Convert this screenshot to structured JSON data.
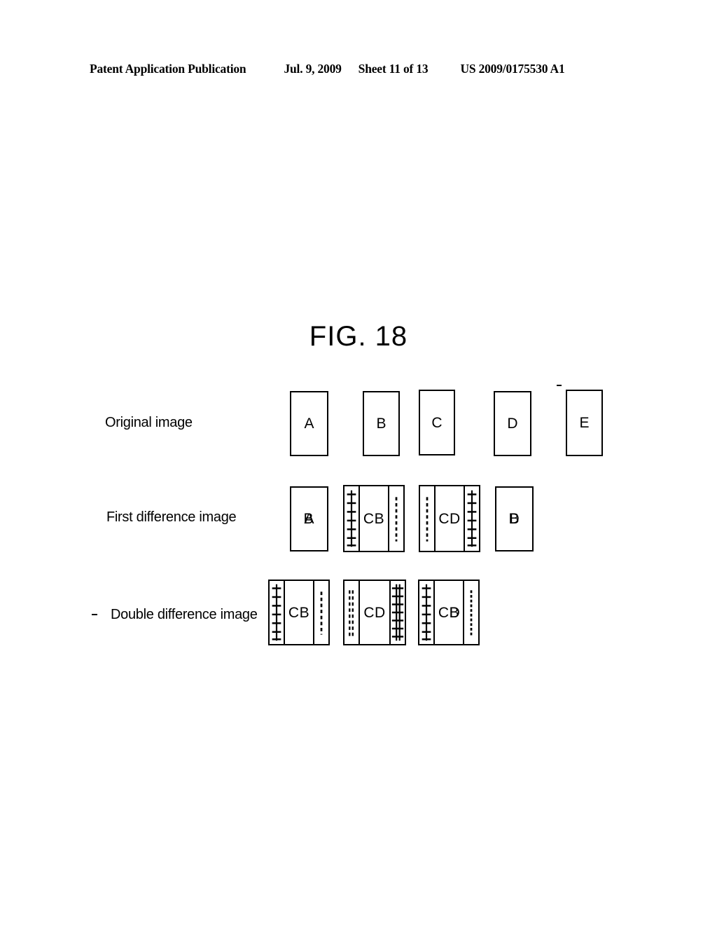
{
  "header": {
    "publication": "Patent Application Publication",
    "date": "Jul. 9, 2009",
    "sheet": "Sheet 11 of 13",
    "patent_number": "US 2009/0175530 A1"
  },
  "figure": {
    "title": "FIG. 18",
    "rows": [
      {
        "label": "Original image",
        "items": [
          {
            "type": "plain",
            "letters": [
              "A"
            ]
          },
          {
            "type": "plain",
            "letters": [
              "B"
            ]
          },
          {
            "type": "plain",
            "letters": [
              "C"
            ]
          },
          {
            "type": "plain",
            "letters": [
              "D"
            ]
          },
          {
            "type": "plain",
            "letters": [
              "E"
            ]
          }
        ]
      },
      {
        "label": "First difference image",
        "items": [
          {
            "type": "plain",
            "letters": [
              "A",
              "B"
            ]
          },
          {
            "type": "composite",
            "letters": [
              "C",
              "B"
            ],
            "left_strip": "cross-ticks",
            "right_strip": "dashed"
          },
          {
            "type": "composite",
            "letters": [
              "C",
              "D"
            ],
            "left_strip": "dashed",
            "right_strip": "cross-ticks"
          },
          {
            "type": "plain",
            "letters": [
              "B",
              "D"
            ]
          }
        ]
      },
      {
        "label": "Double difference image",
        "items": [
          {
            "type": "composite",
            "letters": [
              "C",
              "B"
            ],
            "left_strip": "cross-ticks",
            "right_strip": "dashed"
          },
          {
            "type": "composite",
            "letters": [
              "C",
              "D"
            ],
            "left_strip": "dashed",
            "right_strip": "cross-ticks"
          },
          {
            "type": "composite",
            "letters": [
              "C",
              "B",
              "D"
            ],
            "left_strip": "cross-ticks",
            "right_strip": "dashed"
          }
        ]
      }
    ]
  },
  "colors": {
    "ink": "#000000",
    "paper": "#ffffff"
  }
}
